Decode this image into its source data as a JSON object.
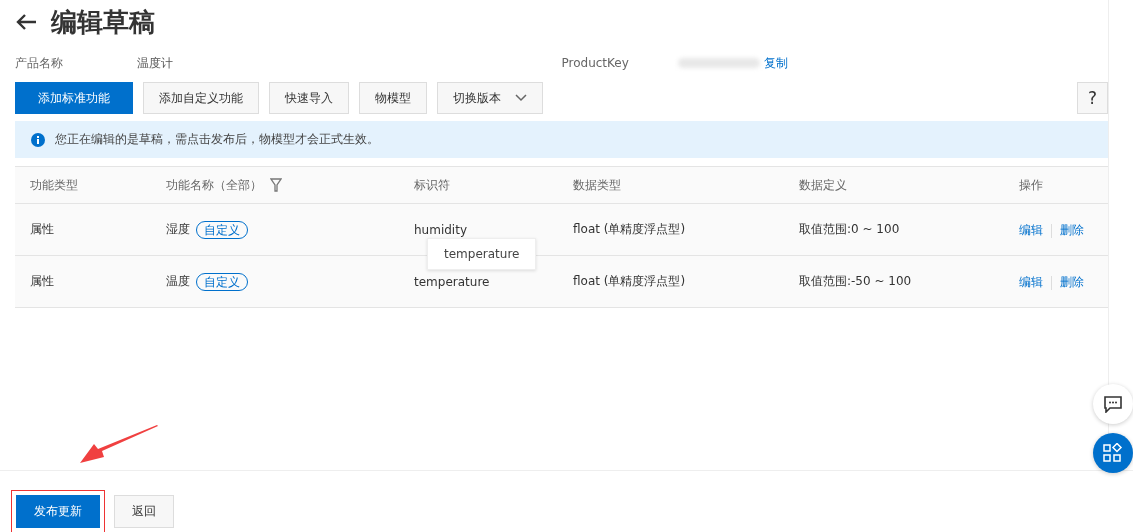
{
  "title": "编辑草稿",
  "info": [
    {
      "label": "产品名称",
      "value": "温度计"
    },
    {
      "label": "ProductKey",
      "value_hidden": true,
      "action": "复制"
    }
  ],
  "toolbar": [
    {
      "label": "添加标准功能",
      "primary": true
    },
    {
      "label": "添加自定义功能",
      "primary": false
    },
    {
      "label": "快速导入",
      "primary": false
    },
    {
      "label": "物模型",
      "primary": false
    },
    {
      "label": "切换版本",
      "primary": false,
      "dropdown": true
    }
  ],
  "help": "?",
  "alert": "您正在编辑的是草稿，需点击发布后，物模型才会正式生效。",
  "table": {
    "columns": [
      "功能类型",
      "功能名称（全部）",
      "标识符",
      "数据类型",
      "数据定义",
      "操作"
    ],
    "rows": [
      {
        "type": "属性",
        "name": "湿度",
        "tag": "自定义",
        "identifier": "humidity",
        "data_type": "float (单精度浮点型)",
        "definition": "取值范围:0 ~ 100",
        "actions": [
          "编辑",
          "删除"
        ],
        "tooltip": "temperature"
      },
      {
        "type": "属性",
        "name": "温度",
        "tag": "自定义",
        "identifier": "temperature",
        "data_type": "float (单精度浮点型)",
        "definition": "取值范围:-50 ~ 100",
        "actions": [
          "编辑",
          "删除"
        ]
      }
    ]
  },
  "footer": [
    {
      "label": "发布更新",
      "primary": true,
      "highlighted": true
    },
    {
      "label": "返回",
      "primary": false,
      "highlighted": false
    }
  ]
}
